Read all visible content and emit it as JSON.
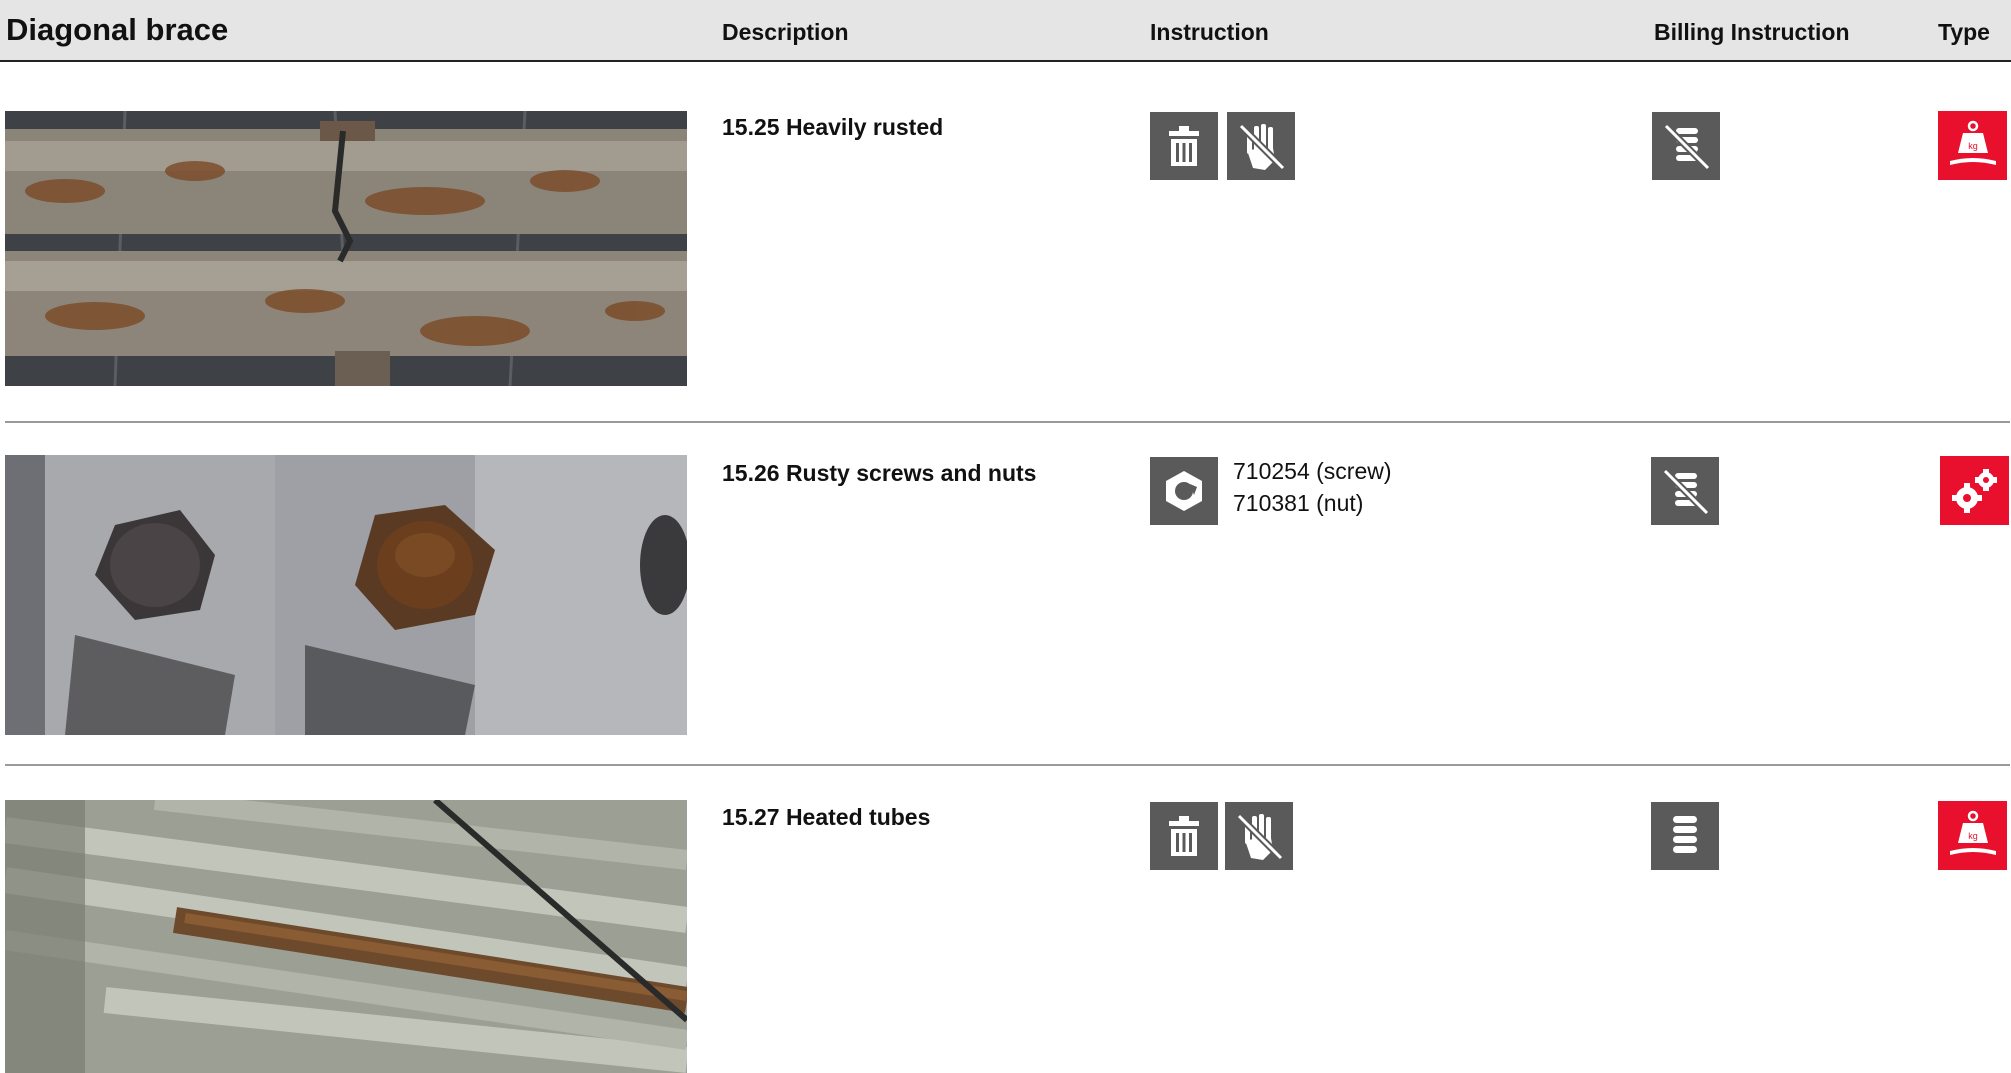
{
  "header": {
    "title": "Diagonal brace",
    "col_description": "Description",
    "col_instruction": "Instruction",
    "col_billing": "Billing Instruction",
    "col_type": "Type"
  },
  "rows": [
    {
      "description": "15.25 Heavily rusted",
      "photo": "rusted-tubes-photo",
      "instruction_icons": [
        "trash-icon",
        "no-manual-handling-icon"
      ],
      "billing_icon": "no-billing-coins-icon",
      "type_icon": "weight-kg-icon",
      "part_numbers": []
    },
    {
      "description": "15.26 Rusty screws and nuts",
      "photo": "rusty-bolts-photo",
      "instruction_icons": [
        "hex-nut-icon"
      ],
      "billing_icon": "no-billing-coins-icon",
      "type_icon": "gears-icon",
      "part_numbers": [
        "710254 (screw)",
        "710381 (nut)"
      ]
    },
    {
      "description": "15.27 Heated tubes",
      "photo": "heated-tubes-photo",
      "instruction_icons": [
        "trash-icon",
        "no-manual-handling-icon"
      ],
      "billing_icon": "billing-coins-icon",
      "type_icon": "weight-kg-icon",
      "part_numbers": []
    }
  ],
  "colors": {
    "header_bg": "#e5e5e5",
    "icon_gray": "#5a5a5a",
    "type_red": "#e8102c",
    "divider": "#9a9a9a"
  }
}
